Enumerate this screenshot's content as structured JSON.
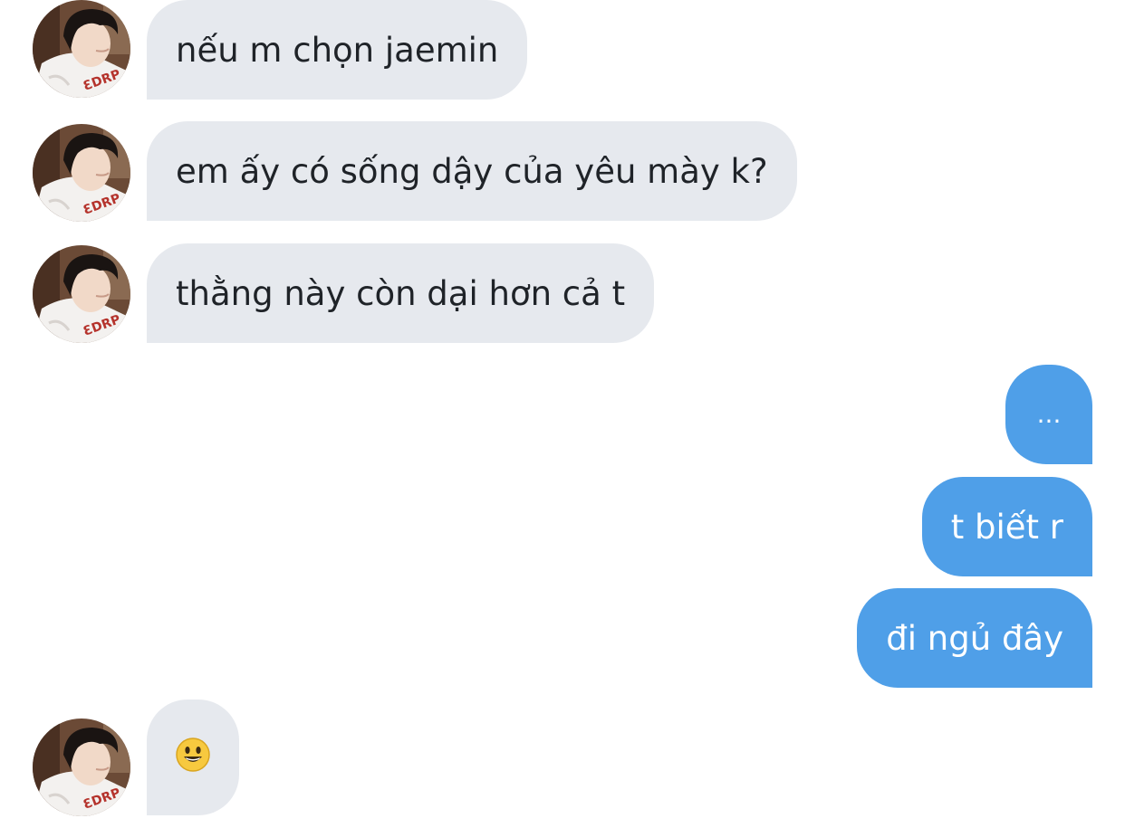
{
  "messages": [
    {
      "side": "incoming",
      "text": "nếu m chọn jaemin"
    },
    {
      "side": "incoming",
      "text": "em ấy có sống dậy của yêu mày k?"
    },
    {
      "side": "incoming",
      "text": "thằng này còn dại hơn cả t"
    },
    {
      "side": "outgoing",
      "text": "..."
    },
    {
      "side": "outgoing",
      "text": "t biết r"
    },
    {
      "side": "outgoing",
      "text": "đi ngủ đây"
    },
    {
      "side": "incoming",
      "text": "😃"
    }
  ],
  "colors": {
    "incoming_bubble": "#e6e9ee",
    "incoming_text": "#1f2328",
    "outgoing_bubble": "#4f9fe8",
    "outgoing_text": "#ffffff"
  },
  "icons": {
    "avatar": "contact-avatar-photo",
    "emoji": "smiling-face-emoji"
  }
}
